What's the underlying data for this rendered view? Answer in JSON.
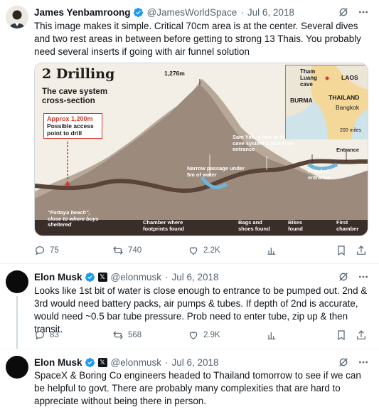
{
  "tweets": [
    {
      "name": "James Yenbamroong",
      "handle": "@JamesWorldSpace",
      "date": "Jul 6, 2018",
      "text": "This image makes it simple. Critical 70cm area is at the center. Several dives and two rest areas in between before getting to strong 13 Thais.  You probably need several inserts if going with air funnel solution",
      "stats": {
        "replies": "75",
        "retweets": "740",
        "likes": "2.2K"
      }
    },
    {
      "name": "Elon Musk",
      "handle": "@elonmusk",
      "date": "Jul 6, 2018",
      "text": "Looks like 1st bit of water is close enough to entrance to be pumped out. 2nd & 3rd would need battery packs, air pumps & tubes. If depth of 2nd is accurate, would need ~0.5 bar tube pressure. Prob need to enter tube, zip up & then transit.",
      "stats": {
        "replies": "83",
        "retweets": "568",
        "likes": "2.9K"
      }
    },
    {
      "name": "Elon Musk",
      "handle": "@elonmusk",
      "date": "Jul 6, 2018",
      "text": "SpaceX & Boring Co engineers headed to Thailand tomorrow to see if we can be helpful to govt. There are probably many complexities that are hard to appreciate without being there in person."
    }
  ],
  "separator": "·",
  "badge_x": "𝕏",
  "infographic": {
    "title": "2 Drilling",
    "subtitle": "The cave system cross-section",
    "approx": "Approx 1,200m",
    "access": "Possible access point to drill",
    "peak": "1,276m",
    "sam_yak": "Sam Yak, a fork in the cave system 3.2km from entrance",
    "narrow": "Narrow passage under 5m of water",
    "flooded": "Flooded entrance",
    "entrance": "Entrance",
    "pattaya": "\"Pattaya beach\", close to where boys sheltered",
    "chamber": "Chamber where footprints found",
    "bags": "Bags and shoes found",
    "bikes": "Bikes found",
    "first_chamber": "First chamber",
    "map": {
      "tham_luang": "Tham Luang cave",
      "laos": "LAOS",
      "burma": "BURMA",
      "thailand": "THAILAND",
      "bangkok": "Bangkok",
      "scale": "200 miles"
    }
  },
  "colors": {
    "verified": "#1d9bf0",
    "muted": "#536471",
    "mountain": "#9c8a7c",
    "sky": "#f3eee6",
    "cave": "#5a4438",
    "accent_red": "#d23b30"
  }
}
